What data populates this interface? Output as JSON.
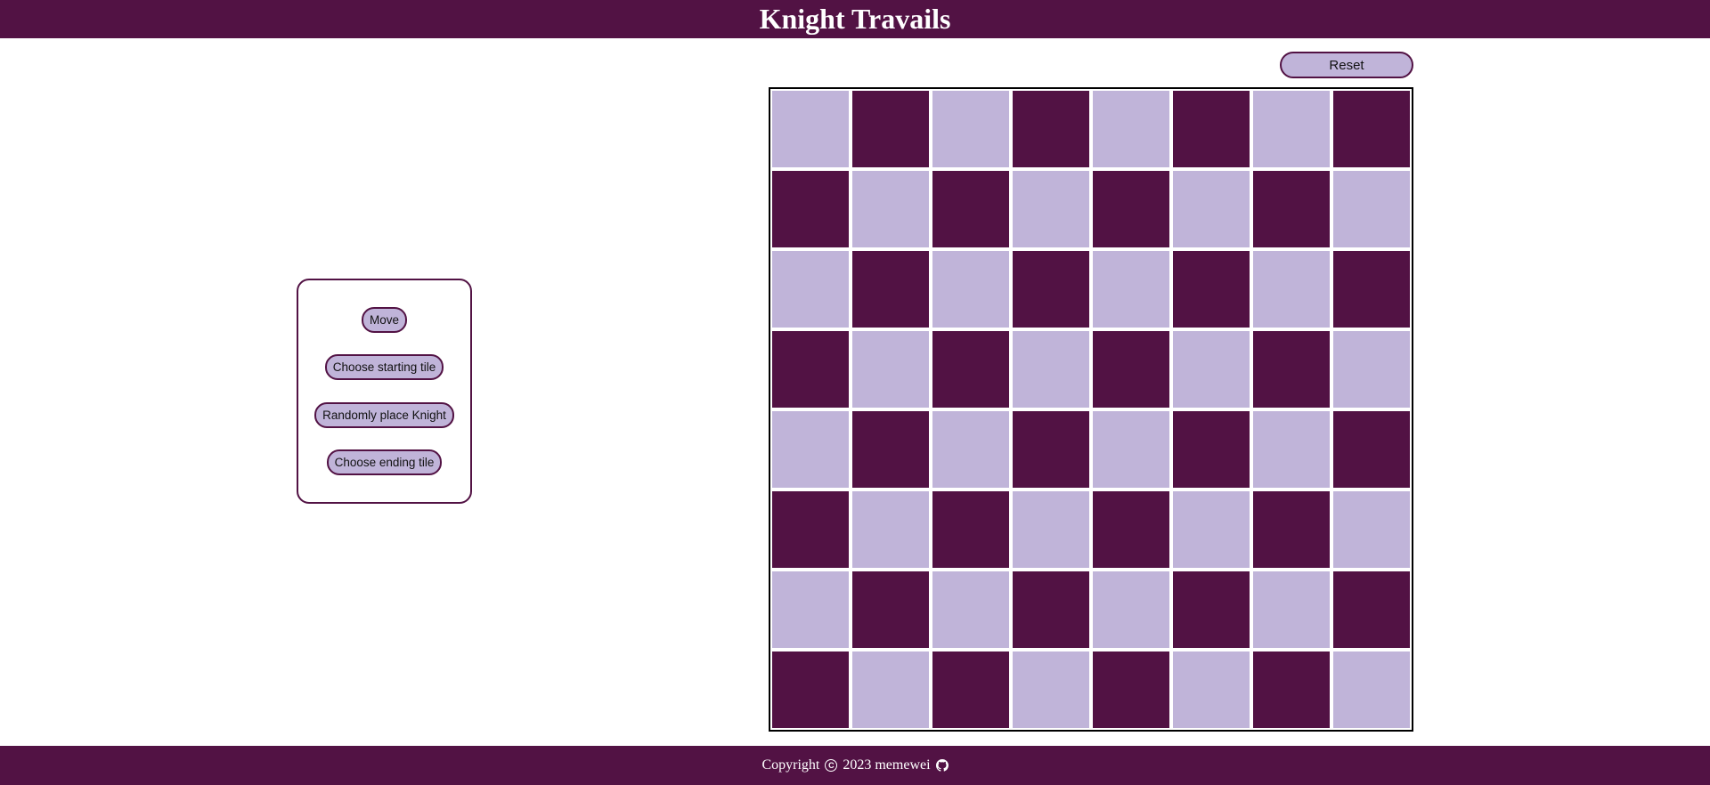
{
  "header": {
    "title": "Knight Travails"
  },
  "toolbar": {
    "reset_label": "Reset"
  },
  "controls": {
    "move_label": "Move",
    "choose_start_label": "Choose starting tile",
    "random_knight_label": "Randomly place Knight",
    "choose_end_label": "Choose ending tile"
  },
  "board": {
    "rows": 8,
    "cols": 8,
    "top_left": "light"
  },
  "footer": {
    "copyright_word": "Copyright",
    "copyright_icon": "copyright-icon",
    "year_author": "2023 memewei",
    "github_icon": "github-icon"
  },
  "colors": {
    "primary": "#521244",
    "light_tile": "#c0b4d9",
    "dark_tile": "#521244",
    "background": "#ffffff"
  }
}
